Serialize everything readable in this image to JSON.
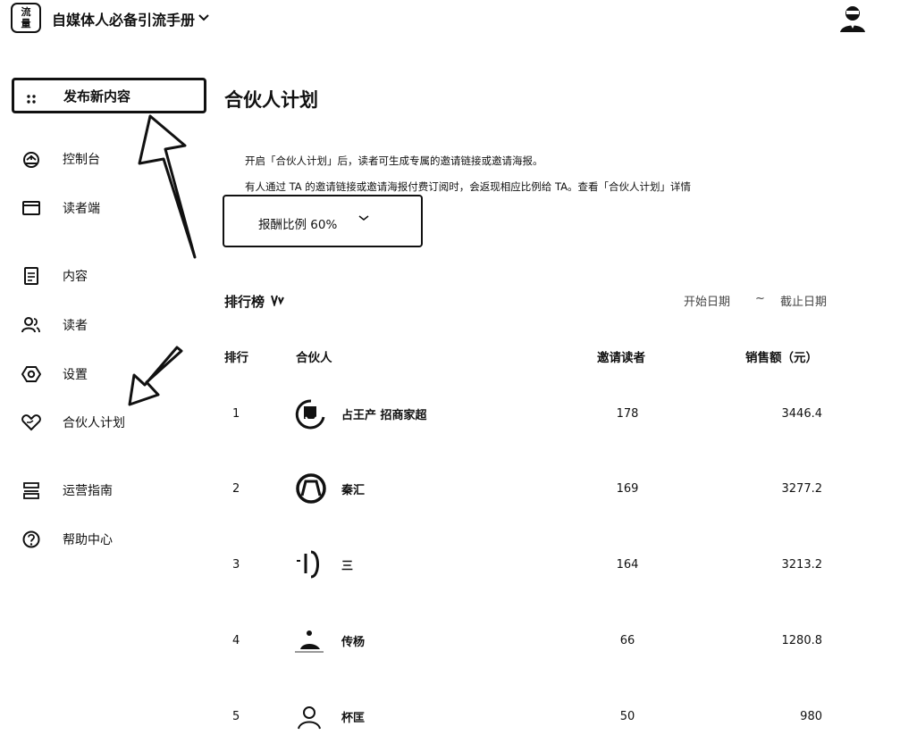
{
  "header": {
    "logo_text_line1": "流",
    "logo_text_line2": "量",
    "app_name": "自媒体人必备引流手册",
    "dropdown_icon": "chevron-down-icon"
  },
  "sidebar": {
    "publish_label": "发布新内容",
    "items": [
      {
        "label": "控制台",
        "icon": "dashboard-icon"
      },
      {
        "label": "读者端",
        "icon": "window-icon"
      },
      {
        "label": "内容",
        "icon": "document-icon"
      },
      {
        "label": "读者",
        "icon": "users-icon"
      },
      {
        "label": "设置",
        "icon": "settings-icon"
      },
      {
        "label": "合伙人计划",
        "icon": "heart-hand-icon"
      },
      {
        "label": "运营指南",
        "icon": "guide-icon"
      },
      {
        "label": "帮助中心",
        "icon": "help-icon"
      }
    ]
  },
  "main": {
    "title": "合伙人计划",
    "description_1": "开启「合伙人计划」后，读者可生成专属的邀请链接或邀请海报。",
    "description_2": "有人通过 TA 的邀请链接或邀请海报付费订阅时，会返现相应比例给 TA。查看「合伙人计划」详情",
    "ratio_label": "报酬比例 60%",
    "ranking_title": "排行榜",
    "date_start": "开始日期",
    "date_sep": "~",
    "date_end": "截止日期",
    "table": {
      "headers": [
        "排行",
        "合伙人",
        "邀请读者",
        "销售额（元）"
      ],
      "rows": [
        {
          "rank": "1",
          "name": "占王产 招商家超",
          "invited": "178",
          "sales": "3446.4"
        },
        {
          "rank": "2",
          "name": "秦汇",
          "invited": "169",
          "sales": "3277.2"
        },
        {
          "rank": "3",
          "name": "三",
          "invited": "164",
          "sales": "3213.2"
        },
        {
          "rank": "4",
          "name": "传杨",
          "invited": "66",
          "sales": "1280.8"
        },
        {
          "rank": "5",
          "name": "杯匡",
          "invited": "50",
          "sales": "980"
        }
      ]
    }
  }
}
